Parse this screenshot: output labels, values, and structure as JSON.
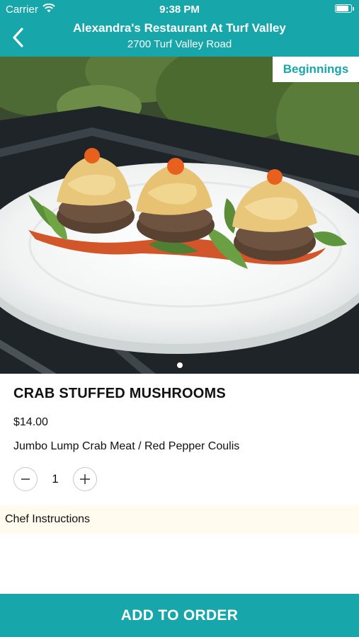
{
  "status_bar": {
    "carrier": "Carrier",
    "time": "9:38 PM"
  },
  "nav": {
    "title": "Alexandra's Restaurant At Turf Valley",
    "subtitle": "2700 Turf Valley Road"
  },
  "hero": {
    "category": "Beginnings"
  },
  "item": {
    "name": "CRAB STUFFED MUSHROOMS",
    "price": "$14.00",
    "description": "Jumbo Lump Crab Meat / Red Pepper Coulis",
    "quantity": "1"
  },
  "chef_instructions": {
    "placeholder": "Chef Instructions"
  },
  "actions": {
    "add_label": "ADD TO ORDER"
  },
  "colors": {
    "accent": "#17a6aa",
    "chef_bg": "#fffbee"
  }
}
